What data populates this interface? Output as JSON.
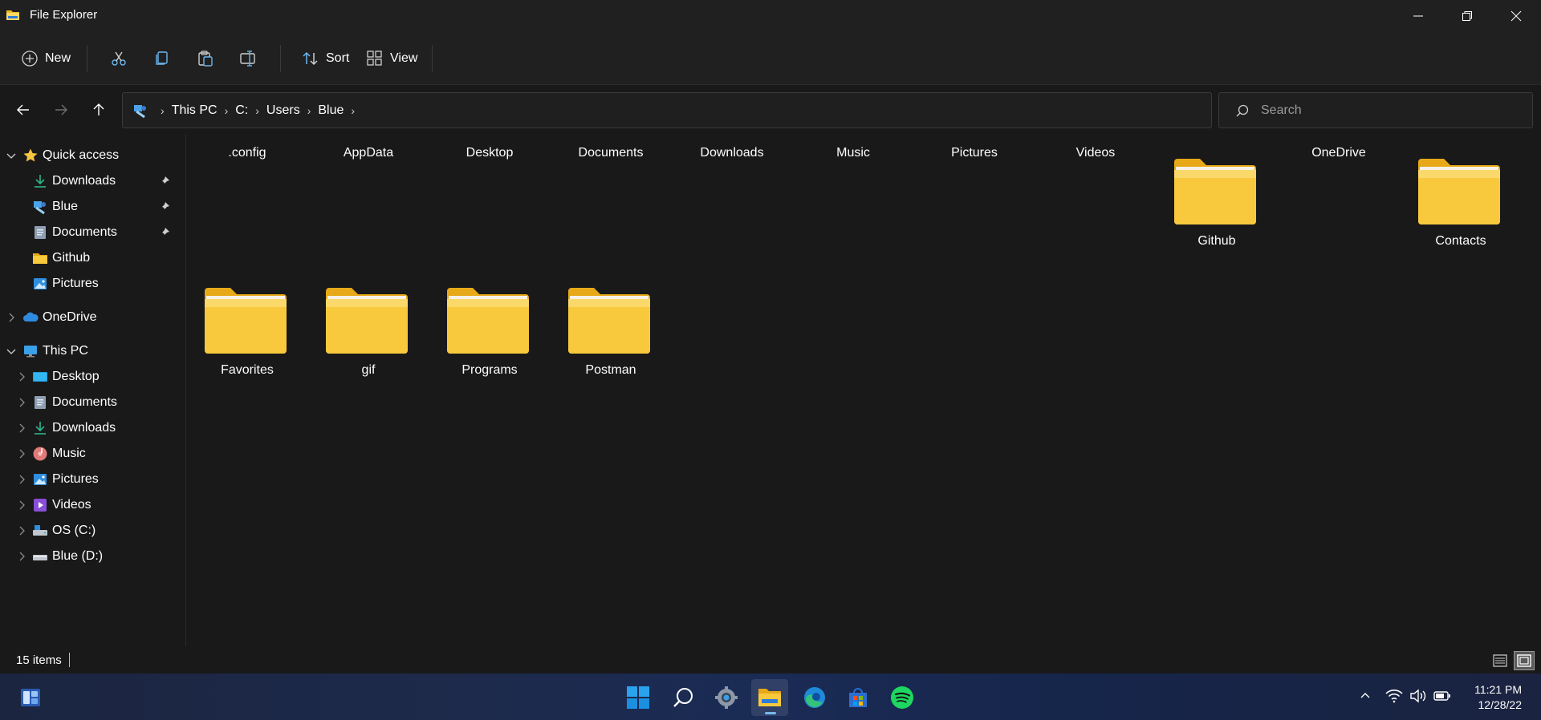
{
  "window": {
    "title": "File Explorer"
  },
  "toolbar": {
    "new_label": "New",
    "sort_label": "Sort",
    "view_label": "View"
  },
  "address": {
    "crumbs": [
      "This PC",
      "C:",
      "Users",
      "Blue"
    ]
  },
  "search": {
    "placeholder": "Search"
  },
  "sidebar": {
    "quick_access": "Quick access",
    "quick_items": [
      "Downloads",
      "Blue",
      "Documents",
      "Github",
      "Pictures"
    ],
    "onedrive": "OneDrive",
    "this_pc": "This PC",
    "pc_items": [
      "Desktop",
      "Documents",
      "Downloads",
      "Music",
      "Pictures",
      "Videos",
      "OS (C:)",
      "Blue (D:)"
    ]
  },
  "content": {
    "top_labels": [
      ".config",
      "AppData",
      "Desktop",
      "Documents",
      "Downloads",
      "Music",
      "Pictures",
      "Videos"
    ],
    "onedrive_label": "OneDrive",
    "folders_row1": [
      "Github",
      "Contacts"
    ],
    "folders_row2": [
      "Favorites",
      "gif",
      "Programs",
      "Postman"
    ]
  },
  "status": {
    "item_count": "15 items"
  },
  "clock": {
    "time": "11:21 PM",
    "date": "12/28/22"
  },
  "taskbar": {
    "icons": [
      "widgets-icon",
      "start-icon",
      "search-icon",
      "settings-icon",
      "file-explorer-icon",
      "edge-icon",
      "store-icon",
      "spotify-icon"
    ]
  },
  "colors": {
    "folder": "#f8c93c",
    "accent": "#76b9ed",
    "background": "#191919"
  }
}
